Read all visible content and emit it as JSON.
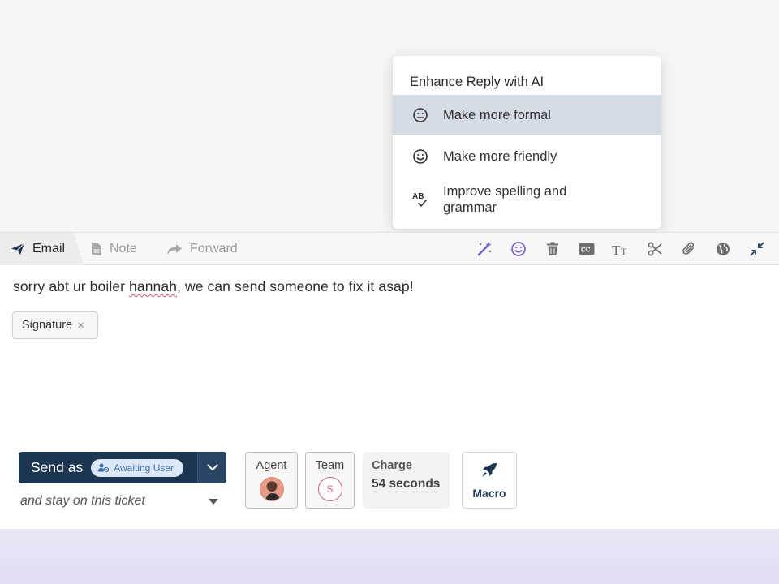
{
  "ai_menu": {
    "title": "Enhance Reply with AI",
    "items": [
      {
        "label": "Make more formal",
        "icon": "neutral-face-icon",
        "highlighted": true
      },
      {
        "label": "Make more friendly",
        "icon": "smile-face-icon",
        "highlighted": false
      },
      {
        "label": "Improve spelling and grammar",
        "icon": "spellcheck-icon",
        "highlighted": false
      }
    ]
  },
  "tabs": {
    "email": "Email",
    "note": "Note",
    "forward": "Forward"
  },
  "toolbar": [
    "ai-wand-icon",
    "emoji-icon",
    "trash-icon",
    "cc-icon",
    "text-format-icon",
    "scissors-icon",
    "attachment-icon",
    "globe-icon",
    "collapse-icon"
  ],
  "message": {
    "before": "sorry abt ur boiler ",
    "misspelled": "hannah",
    "after": ", we can send someone to fix it asap!"
  },
  "signature": {
    "label": "Signature",
    "remove": "×"
  },
  "send": {
    "label": "Send as",
    "status": "Awaiting User",
    "stay": "and stay on this ticket"
  },
  "fields": {
    "agent": "Agent",
    "team": "Team",
    "team_initial": "S",
    "charge_label": "Charge",
    "charge_value": "54 seconds",
    "macro": "Macro"
  },
  "colors": {
    "accent": "#7a5cc7",
    "send_bg": "#1c3552",
    "status_text": "#3c6ea8",
    "highlight": "#d6dce3"
  }
}
